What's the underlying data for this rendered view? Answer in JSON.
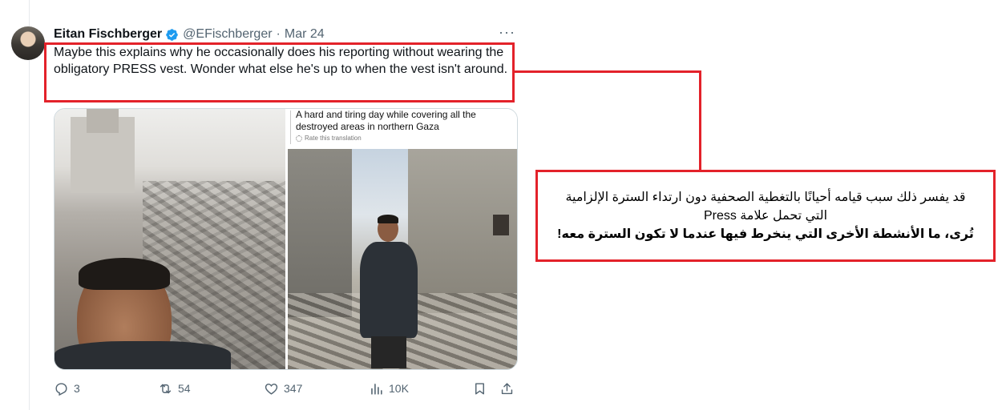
{
  "tweet": {
    "author_name": "Eitan Fischberger",
    "handle": "@EFischberger",
    "separator": "·",
    "date": "Mar 24",
    "more_label": "···",
    "text": "Maybe this explains why he occasionally does his reporting without wearing the obligatory PRESS vest. Wonder what else he's up to when the vest isn't around.",
    "media": {
      "caption": "A hard and tiring day while covering all the destroyed areas in northern Gaza",
      "rate_translation": "Rate this translation"
    },
    "actions": {
      "replies": "3",
      "reposts": "54",
      "likes": "347",
      "views": "10K"
    }
  },
  "translation": {
    "line1": "قد يفسر ذلك سبب قيامه أحيانًا بالتغطية الصحفية دون ارتداء السترة الإلزامية",
    "line2": "التي تحمل علامة Press",
    "line3": "تُرى، ما الأنشطة الأخرى التي ينخرط فيها عندما لا تكون السترة معه!"
  },
  "colors": {
    "highlight": "#e3222a",
    "verified": "#1d9bf0",
    "muted": "#536471"
  }
}
